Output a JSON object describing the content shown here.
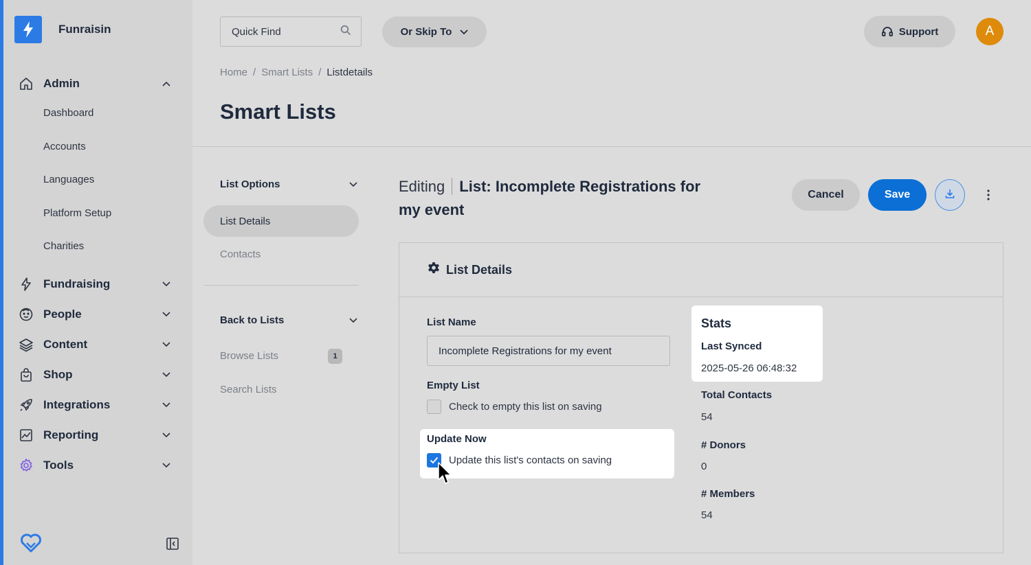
{
  "brand": {
    "name": "Funraisin"
  },
  "sidebar": {
    "admin": {
      "label": "Admin",
      "icon": "home-icon"
    },
    "admin_items": [
      "Dashboard",
      "Accounts",
      "Languages",
      "Platform Setup",
      "Charities"
    ],
    "sections": [
      {
        "label": "Fundraising",
        "icon": "lightning-icon"
      },
      {
        "label": "People",
        "icon": "face-icon"
      },
      {
        "label": "Content",
        "icon": "layers-icon"
      },
      {
        "label": "Shop",
        "icon": "shopping-bag-icon"
      },
      {
        "label": "Integrations",
        "icon": "rocket-icon"
      },
      {
        "label": "Reporting",
        "icon": "chart-icon"
      },
      {
        "label": "Tools",
        "icon": "gear-icon"
      }
    ]
  },
  "topbar": {
    "quick_find_placeholder": "Quick Find",
    "skip_to_label": "Or Skip To",
    "support_label": "Support",
    "avatar_initial": "A"
  },
  "breadcrumb": {
    "home": "Home",
    "smart_lists": "Smart Lists",
    "current": "Listdetails",
    "separator": "/"
  },
  "page": {
    "title": "Smart Lists"
  },
  "list_menu": {
    "options_title": "List Options",
    "options_items": [
      "List Details",
      "Contacts"
    ],
    "back_title": "Back to Lists",
    "browse_label": "Browse Lists",
    "browse_count": "1",
    "search_label": "Search Lists"
  },
  "editor": {
    "editing_label": "Editing",
    "list_title": "List: Incomplete Registrations for my event",
    "cancel_label": "Cancel",
    "save_label": "Save"
  },
  "panel": {
    "title": "List Details",
    "list_name_label": "List Name",
    "list_name_value": "Incomplete Registrations for my event",
    "empty_list_label": "Empty List",
    "empty_list_checkbox": "Check to empty this list on saving",
    "empty_list_checked": false,
    "update_now_label": "Update Now",
    "update_now_checkbox": "Update this list's contacts on saving",
    "update_now_checked": true
  },
  "stats": {
    "title": "Stats",
    "last_synced_label": "Last Synced",
    "last_synced_value": "2025-05-26 06:48:32",
    "total_contacts_label": "Total Contacts",
    "total_contacts_value": "54",
    "donors_label": "# Donors",
    "donors_value": "0",
    "members_label": "# Members",
    "members_value": "54"
  },
  "colors": {
    "accent": "#0b6fd6",
    "sidebar_stripe": "#2c7be5",
    "avatar": "#de8a0b"
  }
}
